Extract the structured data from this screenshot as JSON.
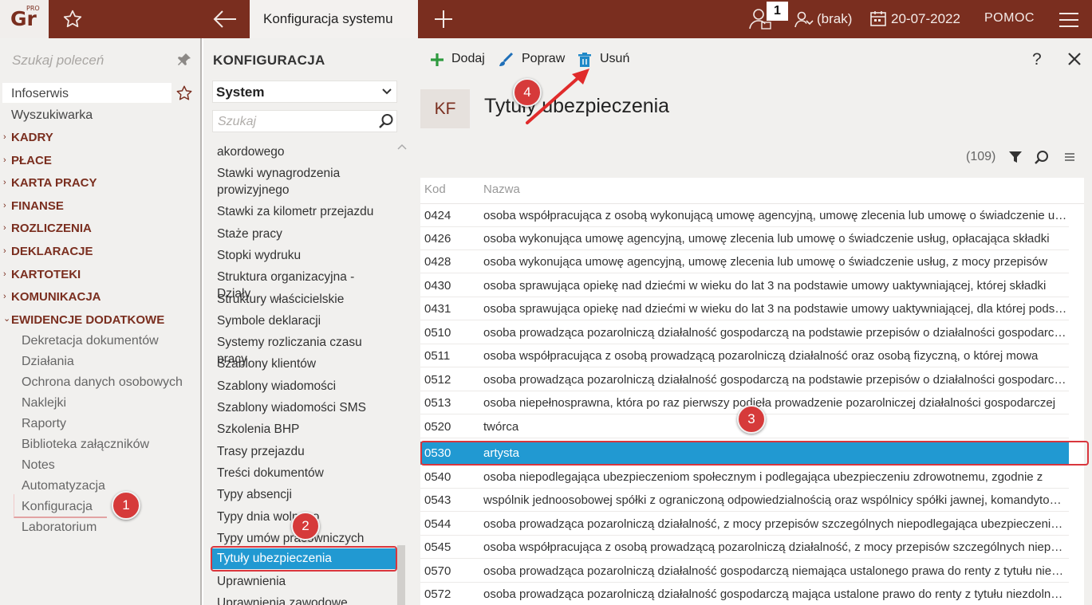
{
  "topbar": {
    "logo_text": "Gr",
    "logo_sup": "PRO",
    "active_tab": "Konfiguracja systemu",
    "user_badge": "1",
    "operator": "(brak)",
    "date": "20-07-2022",
    "help": "POMOC"
  },
  "left": {
    "search_placeholder": "Szukaj poleceń",
    "items": [
      "Infoserwis",
      "Wyszukiwarka"
    ],
    "sections": [
      "KADRY",
      "PŁACE",
      "KARTA PRACY",
      "FINANSE",
      "ROZLICZENIA",
      "DEKLARACJE",
      "KARTOTEKI",
      "KOMUNIKACJA",
      "EWIDENCJE DODATKOWE"
    ],
    "subitems": [
      "Dekretacja dokumentów",
      "Działania",
      "Ochrona danych osobowych",
      "Naklejki",
      "Raporty",
      "Biblioteka załączników",
      "Notes",
      "Automatyzacja",
      "Konfiguracja",
      "Laboratorium"
    ]
  },
  "middle": {
    "title": "KONFIGURACJA",
    "select_value": "System",
    "search_placeholder": "Szukaj",
    "items": [
      "akordowego",
      "Stawki wynagrodzenia prowizyjnego",
      "Stawki za kilometr przejazdu",
      "Staże pracy",
      "Stopki wydruku",
      "Struktura organizacyjna - Działy",
      "Struktury właścicielskie",
      "Symbole deklaracji",
      "Systemy rozliczania czasu pracy",
      "Szablony klientów",
      "Szablony wiadomości",
      "Szablony wiadomości SMS",
      "Szkolenia BHP",
      "Trasy przejazdu",
      "Treści dokumentów",
      "Typy absencji",
      "Typy dnia wolnego",
      "Typy umów pracowniczych"
    ],
    "selected": "Tytuły ubezpieczenia",
    "after": [
      "Uprawnienia",
      "Uprawnienia zawodowe"
    ]
  },
  "toolbar": {
    "add": "Dodaj",
    "edit": "Popraw",
    "delete": "Usuń",
    "help": "?"
  },
  "main": {
    "badge": "KF",
    "title": "Tytuły ubezpieczenia",
    "count": "(109)",
    "columns": [
      "Kod",
      "Nazwa"
    ],
    "rows": [
      [
        "0424",
        "osoba współpracująca z osobą wykonującą umowę agencyjną, umowę zlecenia lub umowę o świadczenie usług"
      ],
      [
        "0426",
        "osoba wykonująca umowę agencyjną, umowę zlecenia lub umowę o świadczenie usług, opłacająca składki"
      ],
      [
        "0428",
        "osoba wykonująca umowę agencyjną, umowę zlecenia lub umowę o świadczenie usług, z mocy przepisów"
      ],
      [
        "0430",
        "osoba sprawująca opiekę nad dziećmi w wieku do lat 3 na podstawie umowy uaktywniającej, której składki"
      ],
      [
        "0431",
        "osoba sprawująca opiekę nad dziećmi w wieku do lat 3 na podstawie umowy uaktywniającej, dla której podstawa"
      ],
      [
        "0510",
        "osoba prowadząca pozarolniczą działalność gospodarczą na podstawie przepisów o działalności gospodarczej"
      ],
      [
        "0511",
        "osoba współpracująca z osobą prowadzącą pozarolniczą działalność oraz osobą fizyczną, o której mowa"
      ],
      [
        "0512",
        "osoba prowadząca pozarolniczą działalność gospodarczą na podstawie przepisów o działalności gospodarczej"
      ],
      [
        "0513",
        "osoba niepełnosprawna, która po raz pierwszy podjęła prowadzenie pozarolniczej działalności gospodarczej"
      ],
      [
        "0520",
        "twórca"
      ],
      [
        "0530",
        "artysta"
      ],
      [
        "0540",
        "osoba niepodlegająca ubezpieczeniom społecznym i podlegająca ubezpieczeniu zdrowotnemu, zgodnie z"
      ],
      [
        "0543",
        "wspólnik jednoosobowej spółki z ograniczoną odpowiedzialnością oraz wspólnicy spółki jawnej, komandytowej"
      ],
      [
        "0544",
        "osoba prowadząca pozarolniczą działalność, z mocy przepisów szczególnych niepodlegająca ubezpieczeniom"
      ],
      [
        "0545",
        "osoba współpracująca z osobą prowadzącą pozarolniczą działalność, z mocy przepisów szczególnych niepodlegająca"
      ],
      [
        "0570",
        "osoba prowadząca pozarolniczą działalność gospodarczą niemająca ustalonego prawa do renty z tytułu niezdolności"
      ],
      [
        "0572",
        "osoba prowadząca pozarolniczą działalność gospodarczą mająca ustalone prawo do renty z tytułu niezdolności"
      ]
    ]
  },
  "callouts": [
    "1",
    "2",
    "3",
    "4"
  ],
  "colors": {
    "brand": "#7a2e1f",
    "selection": "#2199d2",
    "callout": "#d63a3a"
  }
}
